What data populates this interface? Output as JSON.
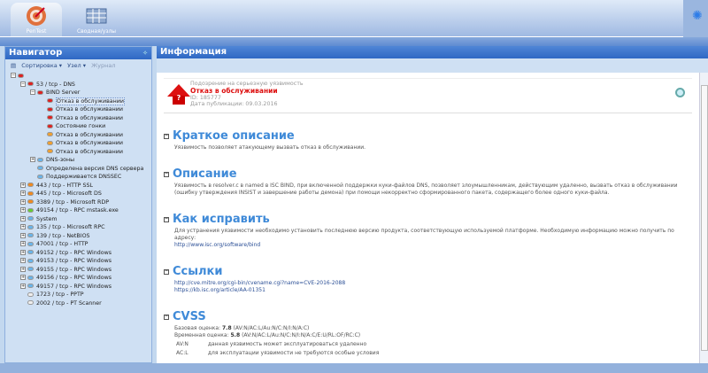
{
  "toolbar": {
    "tabs": [
      {
        "label": "PenTest",
        "icon": "pentest-target-icon"
      },
      {
        "label": "Сводная/узлы",
        "icon": "table-grid-icon"
      }
    ]
  },
  "navigator": {
    "title": "Навигатор",
    "toolbar": {
      "sort": "Сортировка ▾",
      "node": "Узел ▾",
      "journal": "Журнал"
    },
    "tree": [
      {
        "label": "",
        "lvl": 0,
        "color": "#d22"
      },
      {
        "label": "53 / tcp - DNS",
        "lvl": 1,
        "color": "#d22"
      },
      {
        "label": "BIND Server",
        "lvl": 2,
        "color": "#d22"
      },
      {
        "label": "Отказ в обслуживании",
        "lvl": 3,
        "color": "#d22",
        "selected": true
      },
      {
        "label": "Отказ в обслуживании",
        "lvl": 3,
        "color": "#d22"
      },
      {
        "label": "Отказ в обслуживании",
        "lvl": 3,
        "color": "#d22"
      },
      {
        "label": "Состояние гонки",
        "lvl": 3,
        "color": "#d22"
      },
      {
        "label": "Отказ в обслуживании",
        "lvl": 3,
        "color": "#f0a030"
      },
      {
        "label": "Отказ в обслуживании",
        "lvl": 3,
        "color": "#f0a030"
      },
      {
        "label": "Отказ в обслуживании",
        "lvl": 3,
        "color": "#f0a030"
      },
      {
        "label": "DNS-зоны",
        "lvl": 2,
        "color": "#6ab4e8"
      },
      {
        "label": "Определена версия DNS сервера",
        "lvl": 2,
        "color": "#6ab4e8"
      },
      {
        "label": "Поддерживается DNSSEC",
        "lvl": 2,
        "color": "#6ab4e8"
      },
      {
        "label": "443 / tcp - HTTP SSL",
        "lvl": 1,
        "color": "#f08a20"
      },
      {
        "label": "445 / tcp - Microsoft DS",
        "lvl": 1,
        "color": "#f08a20"
      },
      {
        "label": "3389 / tcp - Microsoft RDP",
        "lvl": 1,
        "color": "#f08a20"
      },
      {
        "label": "49154 / tcp - RPC mstask.exe",
        "lvl": 1,
        "color": "#6c3"
      },
      {
        "label": "System",
        "lvl": 1,
        "color": "#6ab4e8"
      },
      {
        "label": "135 / tcp - Microsoft RPC",
        "lvl": 1,
        "color": "#6ab4e8"
      },
      {
        "label": "139 / tcp - NetBIOS",
        "lvl": 1,
        "color": "#6ab4e8"
      },
      {
        "label": "47001 / tcp - HTTP",
        "lvl": 1,
        "color": "#6ab4e8"
      },
      {
        "label": "49152 / tcp - RPC Windows",
        "lvl": 1,
        "color": "#6ab4e8"
      },
      {
        "label": "49153 / tcp - RPC Windows",
        "lvl": 1,
        "color": "#6ab4e8"
      },
      {
        "label": "49155 / tcp - RPC Windows",
        "lvl": 1,
        "color": "#6ab4e8"
      },
      {
        "label": "49156 / tcp - RPC Windows",
        "lvl": 1,
        "color": "#6ab4e8"
      },
      {
        "label": "49157 / tcp - RPC Windows",
        "lvl": 1,
        "color": "#6ab4e8"
      },
      {
        "label": "1723 / tcp - PPTP",
        "lvl": 1,
        "color": "#eee"
      },
      {
        "label": "2002 / tcp - PT Scanner",
        "lvl": 1,
        "color": "#eee"
      }
    ]
  },
  "info": {
    "title": "Информация",
    "header": {
      "suspicion": "Подозрение на серьезную уязвимость",
      "name": "Отказ в обслуживании",
      "id": "ID: 185777",
      "date": "Дата публикации: 09.03.2016"
    },
    "sections": {
      "brief": {
        "title": "Краткое описание",
        "text": "Уязвимость позволяет атакующему вызвать отказ в обслуживании."
      },
      "desc": {
        "title": "Описание",
        "text": "Уязвимость в resolver.c в named в ISC BIND, при включенной поддержки куки-файлов DNS, позволяет злоумышленникам, действующим удаленно, вызвать отказ в обслуживании (ошибку утверждения INSIST и завершение работы демона) при помощи некорректно сформированного пакета, содержащего более одного куки-файла."
      },
      "fix": {
        "title": "Как исправить",
        "text": "Для устранения уязвимости необходимо установить последнюю версию продукта, соответствующую используемой платформе. Необходимую информацию можно получить по адресу:",
        "link": "http://www.isc.org/software/bind"
      },
      "links": {
        "title": "Ссылки",
        "items": [
          "http://cve.mitre.org/cgi-bin/cvename.cgi?name=CVE-2016-2088",
          "https://kb.isc.org/article/AA-01351"
        ]
      },
      "cvss": {
        "title": "CVSS",
        "base_label": "Базовая оценка:",
        "base_score": "7.8",
        "base_vector": "(AV:N/AC:L/Au:N/C:N/I:N/A:C)",
        "temp_label": "Временная оценка:",
        "temp_score": "5.8",
        "temp_vector": "(AV:N/AC:L/Au:N/C:N/I:N/A:C/E:U/RL:OF/RC:C)",
        "rows": [
          {
            "k": "AV:N",
            "v": "данная уязвимость может эксплуатироваться удаленно"
          },
          {
            "k": "AC:L",
            "v": "для эксплуатации уязвимости не требуются особые условия"
          }
        ]
      }
    }
  }
}
